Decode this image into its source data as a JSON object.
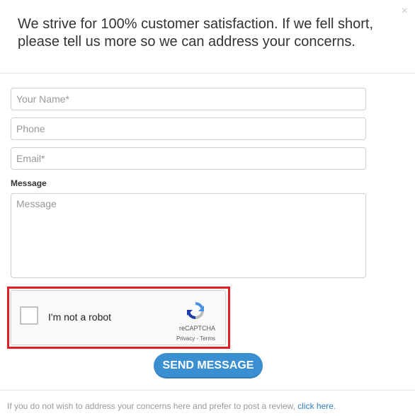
{
  "modal": {
    "close_label": "×",
    "heading": "We strive for 100% customer satisfaction. If we fell short, please tell us more so we can address your concerns."
  },
  "form": {
    "name": {
      "placeholder": "Your Name*",
      "value": ""
    },
    "phone": {
      "placeholder": "Phone",
      "value": ""
    },
    "email": {
      "placeholder": "Email*",
      "value": ""
    },
    "message_label": "Message",
    "message": {
      "placeholder": "Message",
      "value": ""
    }
  },
  "recaptcha": {
    "checkbox_checked": false,
    "label": "I'm not a robot",
    "brand": "reCAPTCHA",
    "privacy_label": "Privacy",
    "separator": " - ",
    "terms_label": "Terms",
    "highlight_color": "#e21f26"
  },
  "send_button": {
    "label": "SEND MESSAGE",
    "color": "#3a8fd0"
  },
  "footer": {
    "text": "If you do not wish to address your concerns here and prefer to post a review, ",
    "link_label": "click here",
    "trailing": ".",
    "link_color": "#2f7fc1"
  },
  "icons": {
    "close": "close-icon",
    "recaptcha_logo": "recaptcha-logo-icon"
  }
}
